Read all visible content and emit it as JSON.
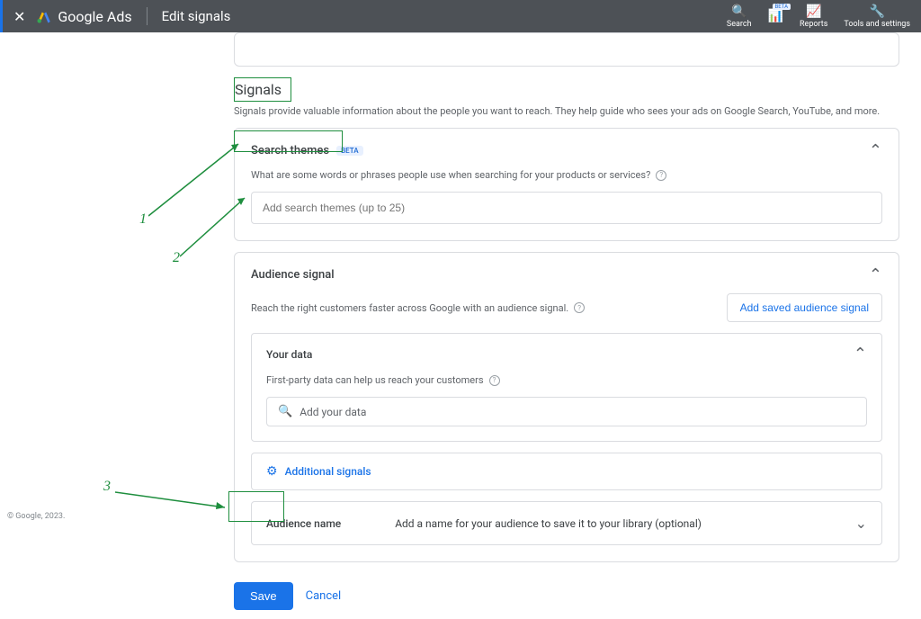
{
  "topbar": {
    "product": "Google Ads",
    "page_title": "Edit signals",
    "nav": {
      "search": "Search",
      "reports": "Reports",
      "tools": "Tools and settings",
      "beta_badge": "BETA",
      "highlighted": ""
    }
  },
  "signals": {
    "title": "Signals",
    "subtitle": "Signals provide valuable information about the people you want to reach. They help guide who sees your ads on Google Search, YouTube, and more."
  },
  "search_themes": {
    "title": "Search themes",
    "badge": "BETA",
    "helper": "What are some words or phrases people use when searching for your products or services?",
    "placeholder": "Add search themes (up to 25)"
  },
  "audience": {
    "title": "Audience signal",
    "helper": "Reach the right customers faster across Google with an audience signal.",
    "add_saved": "Add saved audience signal",
    "your_data": {
      "title": "Your data",
      "helper": "First-party data can help us reach your customers",
      "placeholder": "Add your data"
    },
    "additional": "Additional signals",
    "name_label": "Audience name",
    "name_hint": "Add a name for your audience to save it to your library (optional)"
  },
  "actions": {
    "save": "Save",
    "cancel": "Cancel"
  },
  "copyright": "© Google, 2023.",
  "annotations": {
    "n1": "1",
    "n2": "2",
    "n3": "3"
  }
}
